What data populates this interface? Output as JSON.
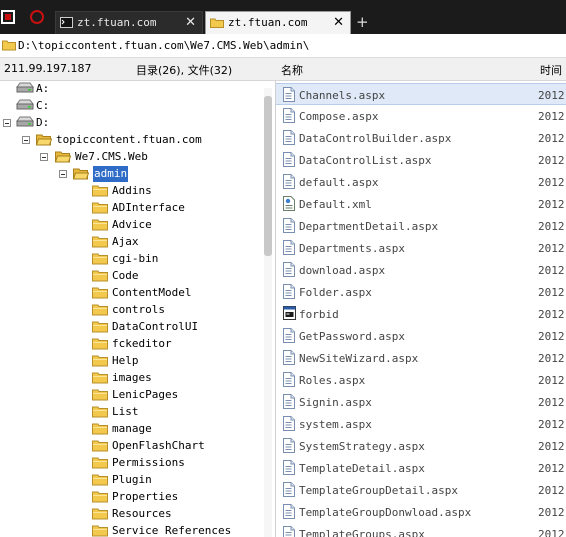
{
  "tabs": [
    {
      "label": "zt.ftuan.com",
      "active": false
    },
    {
      "label": "zt.ftuan.com",
      "active": true
    }
  ],
  "tab_close_glyph": "✕",
  "new_tab_glyph": "+",
  "path": "D:\\topiccontent.ftuan.com\\We7.CMS.Web\\admin\\",
  "status": {
    "ip": "211.99.197.187",
    "counts": "目录(26), 文件(32)"
  },
  "columns": {
    "name": "名称",
    "time": "时间"
  },
  "tree": {
    "drives": [
      "A:",
      "C:",
      "D:"
    ],
    "site": "topiccontent.ftuan.com",
    "web": "We7.CMS.Web",
    "selected": "admin",
    "folders": [
      "Addins",
      "ADInterface",
      "Advice",
      "Ajax",
      "cgi-bin",
      "Code",
      "ContentModel",
      "controls",
      "DataControlUI",
      "fckeditor",
      "Help",
      "images",
      "LenicPages",
      "List",
      "manage",
      "OpenFlashChart",
      "Permissions",
      "Plugin",
      "Properties",
      "Resources",
      "Service References"
    ]
  },
  "files": [
    {
      "name": "Channels.aspx",
      "date": "2012-",
      "icon": "aspx-file-icon",
      "selected": true
    },
    {
      "name": "Compose.aspx",
      "date": "2012-",
      "icon": "aspx-file-icon"
    },
    {
      "name": "DataControlBuilder.aspx",
      "date": "2012-",
      "icon": "aspx-file-icon"
    },
    {
      "name": "DataControlList.aspx",
      "date": "2012-",
      "icon": "aspx-file-icon"
    },
    {
      "name": "default.aspx",
      "date": "2012-",
      "icon": "aspx-file-icon"
    },
    {
      "name": "Default.xml",
      "date": "2012-",
      "icon": "xml-file-icon"
    },
    {
      "name": "DepartmentDetail.aspx",
      "date": "2012-",
      "icon": "aspx-file-icon"
    },
    {
      "name": "Departments.aspx",
      "date": "2012-",
      "icon": "aspx-file-icon"
    },
    {
      "name": "download.aspx",
      "date": "2012-",
      "icon": "aspx-file-icon"
    },
    {
      "name": "Folder.aspx",
      "date": "2012-",
      "icon": "aspx-file-icon"
    },
    {
      "name": "forbid",
      "date": "2012-",
      "icon": "generic-file-icon"
    },
    {
      "name": "GetPassword.aspx",
      "date": "2012-",
      "icon": "aspx-file-icon"
    },
    {
      "name": "NewSiteWizard.aspx",
      "date": "2012-",
      "icon": "aspx-file-icon"
    },
    {
      "name": "Roles.aspx",
      "date": "2012-",
      "icon": "aspx-file-icon"
    },
    {
      "name": "Signin.aspx",
      "date": "2012-",
      "icon": "aspx-file-icon"
    },
    {
      "name": "system.aspx",
      "date": "2012-",
      "icon": "aspx-file-icon"
    },
    {
      "name": "SystemStrategy.aspx",
      "date": "2012-",
      "icon": "aspx-file-icon"
    },
    {
      "name": "TemplateDetail.aspx",
      "date": "2012-",
      "icon": "aspx-file-icon"
    },
    {
      "name": "TemplateGroupDetail.aspx",
      "date": "2012-",
      "icon": "aspx-file-icon"
    },
    {
      "name": "TemplateGroupDonwload.aspx",
      "date": "2012-",
      "icon": "aspx-file-icon"
    },
    {
      "name": "TemplateGroups.aspx",
      "date": "2012-",
      "icon": "aspx-file-icon"
    }
  ],
  "colors": {
    "selection": "#2f6cc7",
    "folder": "#f2c94c",
    "tabbar": "#1b1b1b",
    "file_selected_bg": "#dfe9f7"
  }
}
